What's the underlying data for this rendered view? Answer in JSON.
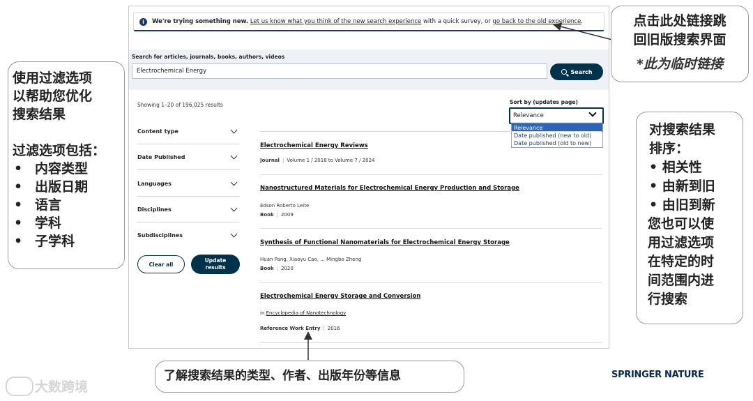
{
  "banner": {
    "prefix": "We're trying something new.",
    "survey_link": "Let us know what you think of the new search experience",
    "middle": "with a quick survey, or",
    "old_link": "go back to the old experience",
    "suffix": "."
  },
  "search": {
    "label": "Search for articles, journals, books, authors, videos",
    "value": "Electrochemical Energy",
    "button_label": "Search"
  },
  "results_count": "Showing 1–20 of 196,025 results",
  "filters": [
    {
      "label": "Content type"
    },
    {
      "label": "Date Published"
    },
    {
      "label": "Languages"
    },
    {
      "label": "Disciplines"
    },
    {
      "label": "Subdisciplines"
    }
  ],
  "actions": {
    "clear_all": "Clear all",
    "update_line1": "Update",
    "update_line2": "results"
  },
  "sort": {
    "label": "Sort by (updates page)",
    "selected": "Relevance",
    "options": [
      "Relevance",
      "Date published (new to old)",
      "Date published (old to new)"
    ]
  },
  "results": [
    {
      "title": "Electrochemical Energy Reviews",
      "type": "Journal",
      "detail": "Volume 1 / 2018 to Volume 7 / 2024"
    },
    {
      "title": "Nanostructured Materials for Electrochemical Energy Production and Storage",
      "authors": "Edson Roberto Leite",
      "type": "Book",
      "year": "2009"
    },
    {
      "title": "Synthesis of Functional Nanomaterials for Electrochemical Energy Storage",
      "authors": "Huan Pang, Xiaoyu Cao, ... Mingbo Zheng",
      "type": "Book",
      "year": "2020"
    },
    {
      "title": "Electrochemical Energy Storage and Conversion",
      "in_prefix": "in",
      "in_link": "Encyclopedia of Nanotechnology",
      "type": "Reference Work Entry",
      "year": "2016"
    }
  ],
  "annotations": {
    "left": {
      "lines": [
        "使用过滤选项",
        "以帮助您优化",
        "搜索结果",
        "",
        "过滤选项包括："
      ],
      "items": [
        "内容类型",
        "出版日期",
        "语言",
        "学科",
        "子学科"
      ]
    },
    "top_right": {
      "line1": "点击此处链接跳",
      "line2": "回旧版搜索界面",
      "note": "*此为临时链接"
    },
    "right": {
      "lines": [
        "对搜索结果",
        "排序："
      ],
      "items": [
        "相关性",
        "由新到旧",
        "由旧到新"
      ],
      "tail": [
        "您也可以使",
        "用过滤选项",
        "在特定的时",
        "间范围内进",
        "行搜索"
      ]
    },
    "bottom": "了解搜索结果的类型、作者、出版年份等信息"
  },
  "brand": "SPRINGER NATURE",
  "watermark": "大数跨境"
}
